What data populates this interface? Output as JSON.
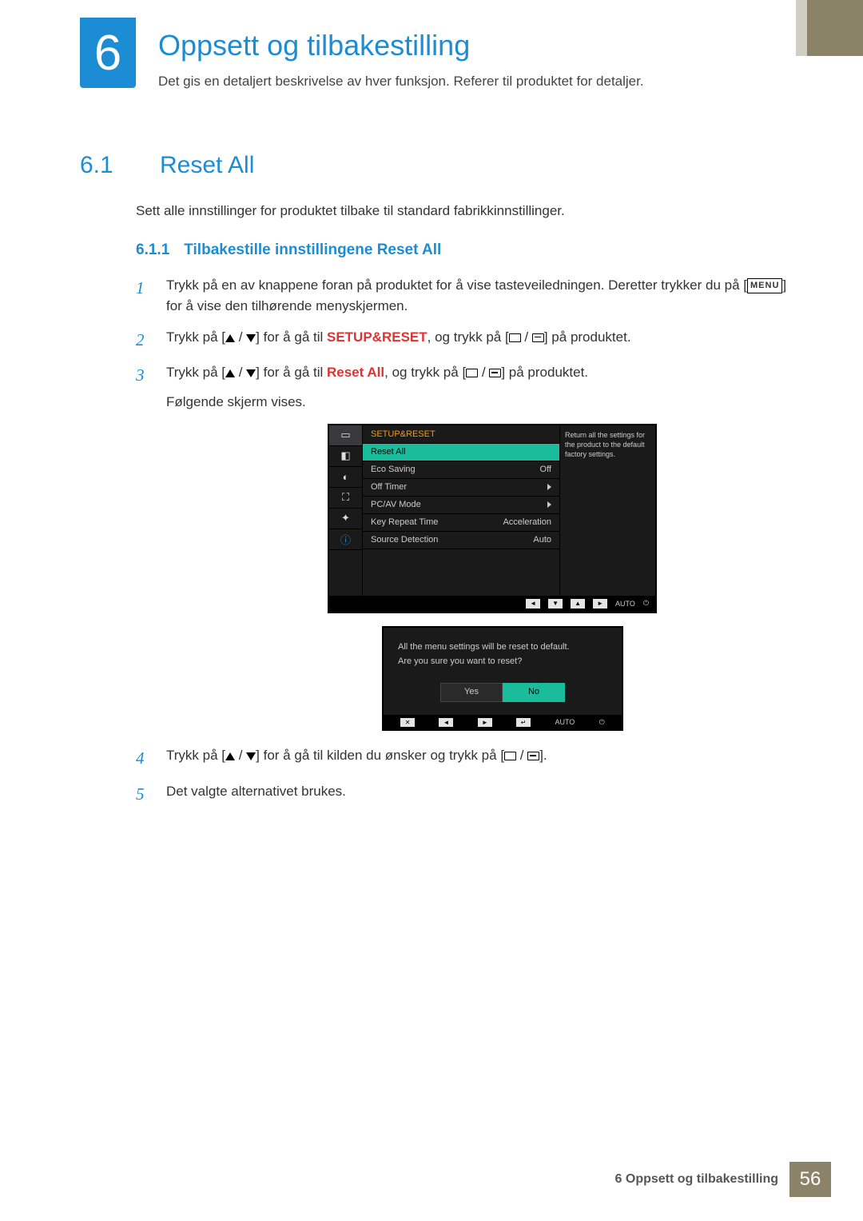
{
  "chapter": {
    "number": "6",
    "title": "Oppsett og tilbakestilling",
    "subtitle": "Det gis en detaljert beskrivelse av hver funksjon. Referer til produktet for detaljer."
  },
  "section": {
    "number": "6.1",
    "title": "Reset All",
    "description": "Sett alle innstillinger for produktet tilbake til standard fabrikkinnstillinger."
  },
  "subsection": {
    "number": "6.1.1",
    "title": "Tilbakestille innstillingene Reset All"
  },
  "steps": {
    "s1": {
      "n": "1",
      "a": "Trykk på en av knappene foran på produktet for å vise tasteveiledningen. Deretter trykker du på [",
      "menu": "MENU",
      "b": "] for å vise den tilhørende menyskjermen."
    },
    "s2": {
      "n": "2",
      "a": "Trykk på [",
      "b": "] for å gå til ",
      "target": "SETUP&RESET",
      "c": ", og trykk på [",
      "d": "] på produktet."
    },
    "s3": {
      "n": "3",
      "a": "Trykk på [",
      "b": "] for å gå til ",
      "target": "Reset All",
      "c": ", og trykk på [",
      "d": "] på produktet.",
      "follow": "Følgende skjerm vises."
    },
    "s4": {
      "n": "4",
      "a": "Trykk på [",
      "b": "] for å gå til kilden du ønsker og trykk på [",
      "c": "]."
    },
    "s5": {
      "n": "5",
      "a": "Det valgte alternativet brukes."
    }
  },
  "osd": {
    "header": "SETUP&RESET",
    "info": "Return all the settings for the product to the default factory settings.",
    "rows": [
      {
        "label": "Reset All",
        "value": ""
      },
      {
        "label": "Eco Saving",
        "value": "Off"
      },
      {
        "label": "Off Timer",
        "value": "▶"
      },
      {
        "label": "PC/AV Mode",
        "value": "▶"
      },
      {
        "label": "Key Repeat Time",
        "value": "Acceleration"
      },
      {
        "label": "Source Detection",
        "value": "Auto"
      }
    ],
    "bar_auto": "AUTO"
  },
  "dialog": {
    "line1": "All the menu settings will be reset to default.",
    "line2": "Are you sure you want to reset?",
    "yes": "Yes",
    "no": "No",
    "bar_auto": "AUTO"
  },
  "footer": {
    "label": "6 Oppsett og tilbakestilling",
    "page": "56"
  }
}
